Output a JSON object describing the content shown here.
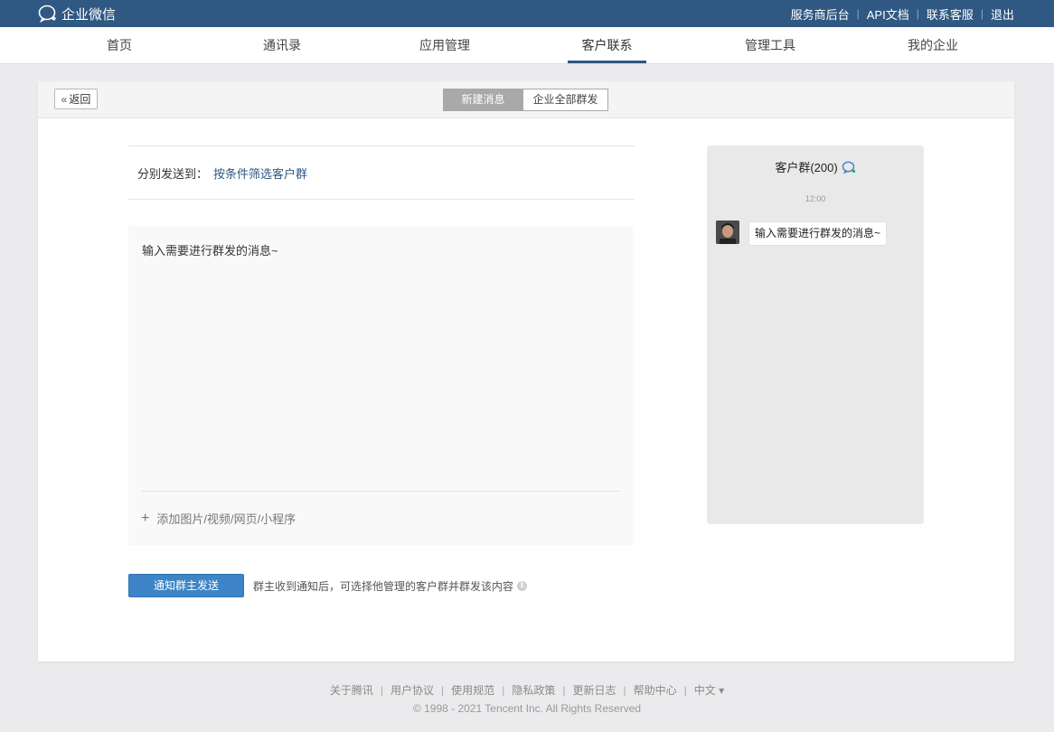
{
  "app": {
    "brand": "企业微信",
    "top_links": [
      "服务商后台",
      "API文档",
      "联系客服",
      "退出"
    ]
  },
  "nav": {
    "items": [
      "首页",
      "通讯录",
      "应用管理",
      "客户联系",
      "管理工具",
      "我的企业"
    ],
    "active": "客户联系"
  },
  "card": {
    "back_label": "返回",
    "tabs": [
      "新建消息",
      "企业全部群发"
    ],
    "active_tab": "新建消息"
  },
  "compose": {
    "send_to_label": "分别发送到：",
    "send_to_link": "按条件筛选客户群",
    "message_text": "输入需要进行群发的消息~",
    "attach_label": "添加图片/视频/网页/小程序",
    "send_button": "通知群主发送",
    "send_note": "群主收到通知后，可选择他管理的客户群并群发该内容"
  },
  "preview": {
    "title": "客户群(200)",
    "time": "12:00",
    "bubble_text": "输入需要进行群发的消息~"
  },
  "footer": {
    "links": [
      "关于腾讯",
      "用户协议",
      "使用规范",
      "隐私政策",
      "更新日志",
      "帮助中心"
    ],
    "language": "中文 ▾",
    "copyright": "© 1998 - 2021 Tencent Inc. All Rights Reserved"
  },
  "colors": {
    "topbar": "#2f5882",
    "accent": "#3d85c6",
    "link": "#2f5882"
  }
}
